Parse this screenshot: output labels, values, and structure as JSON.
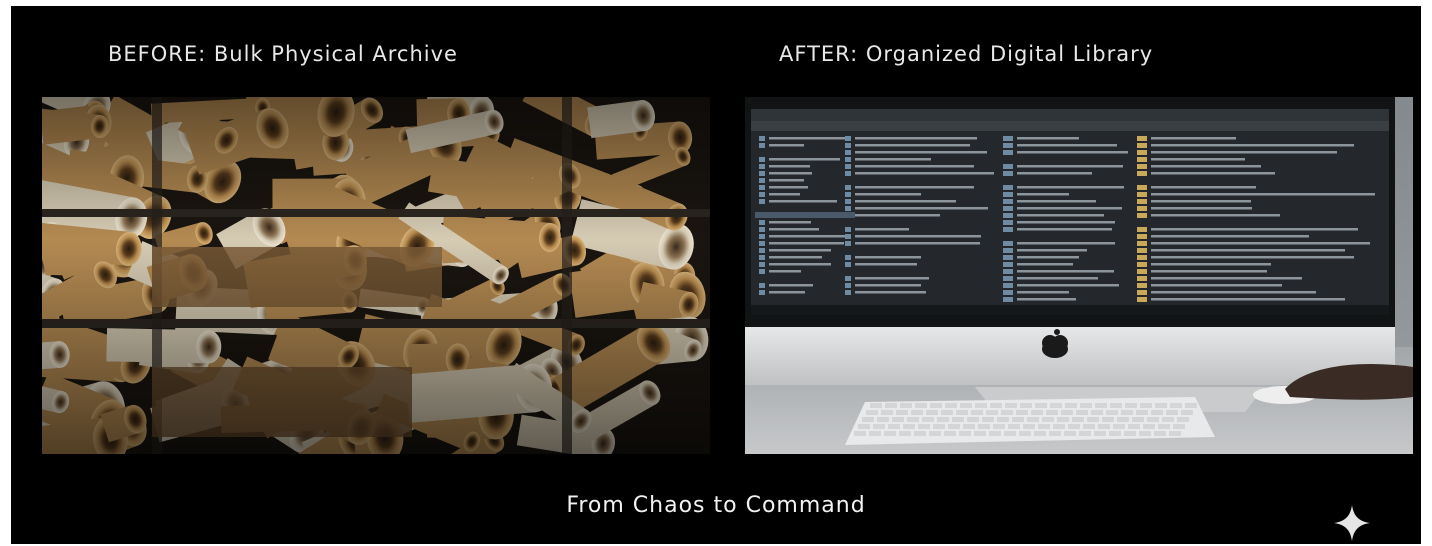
{
  "headings": {
    "before": "BEFORE: Bulk Physical Archive",
    "after": "AFTER: Organized Digital Library"
  },
  "tagline": "From Chaos to Command",
  "icons": {
    "corner": "sparkle-icon",
    "monitor_logo": "apple-logo-icon"
  },
  "colors": {
    "background": "#000000",
    "text": "#e8e8e8",
    "paper": "#c9a56a",
    "screen": "#24282c"
  }
}
